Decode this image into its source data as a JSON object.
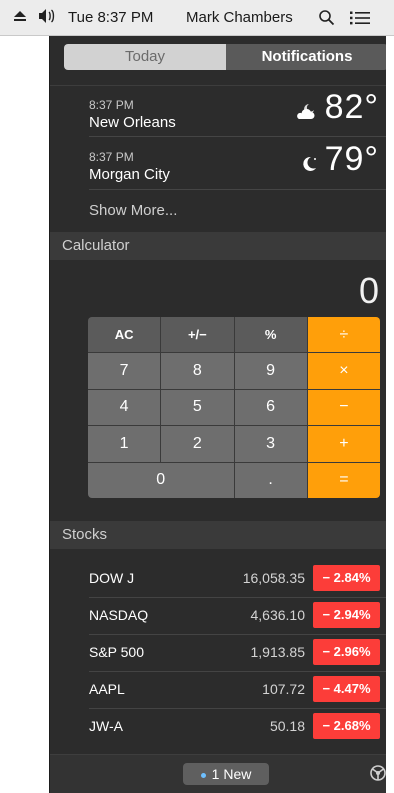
{
  "menubar": {
    "clock": "Tue 8:37 PM",
    "user": "Mark Chambers",
    "icons": [
      "eject-icon",
      "volume-icon",
      "spotlight-search-icon",
      "notification-center-icon"
    ]
  },
  "segmented": {
    "today_label": "Today",
    "notifications_label": "Notifications"
  },
  "weather": {
    "items": [
      {
        "time": "8:37 PM",
        "city": "New Orleans",
        "temp": "82°",
        "icon": "partly-cloudy-night-icon"
      },
      {
        "time": "8:37 PM",
        "city": "Morgan City",
        "temp": "79°",
        "icon": "clear-night-icon"
      }
    ],
    "show_more": "Show More..."
  },
  "calculator": {
    "title": "Calculator",
    "display": "0",
    "keys": {
      "ac": "AC",
      "plusminus": "+/−",
      "percent": "%",
      "divide": "÷",
      "seven": "7",
      "eight": "8",
      "nine": "9",
      "multiply": "×",
      "four": "4",
      "five": "5",
      "six": "6",
      "minus": "−",
      "one": "1",
      "two": "2",
      "three": "3",
      "plus": "+",
      "zero": "0",
      "decimal": ".",
      "equals": "="
    }
  },
  "stocks": {
    "title": "Stocks",
    "rows": [
      {
        "name": "DOW J",
        "price": "16,058.35",
        "change": "− 2.84%"
      },
      {
        "name": "NASDAQ",
        "price": "4,636.10",
        "change": "− 2.94%"
      },
      {
        "name": "S&P 500",
        "price": "1,913.85",
        "change": "− 2.96%"
      },
      {
        "name": "AAPL",
        "price": "107.72",
        "change": "− 4.47%"
      },
      {
        "name": "JW-A",
        "price": "50.18",
        "change": "− 2.68%"
      }
    ]
  },
  "footer": {
    "new_label": "1 New"
  },
  "colors": {
    "panel_bg": "#2c2c2c",
    "calc_operator": "#ff9f0a",
    "stock_down": "#fc3d39"
  }
}
